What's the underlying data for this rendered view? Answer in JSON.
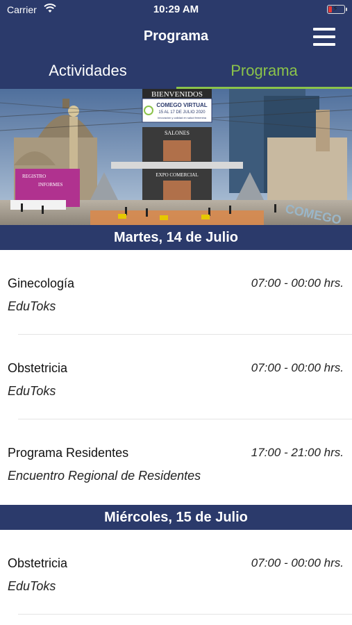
{
  "status_bar": {
    "carrier": "Carrier",
    "time": "10:29 AM",
    "battery_level": 0.15
  },
  "nav": {
    "title": "Programa",
    "menu_icon": "hamburger-menu-icon"
  },
  "tabs": [
    {
      "label": "Actividades",
      "active": false
    },
    {
      "label": "Programa",
      "active": true
    }
  ],
  "banner": {
    "welcome": "BIENVENIDOS",
    "event_title": "COMEGO VIRTUAL",
    "event_dates": "15 AL 17 DE JULIO 2020",
    "event_tagline": "Innovación y calidad en salud femenina",
    "booth_top": "SALONES",
    "booth_bottom": "EXPO COMERCIAL",
    "side_sign_1": "REGISTRO",
    "side_sign_2": "INFORMES",
    "corner_logo": "COMEGO"
  },
  "days": [
    {
      "label": "Martes, 14 de Julio",
      "items": [
        {
          "name": "Ginecología",
          "time": "07:00 - 00:00 hrs.",
          "sub": "EduToks"
        },
        {
          "name": "Obstetricia",
          "time": "07:00 - 00:00 hrs.",
          "sub": "EduToks"
        },
        {
          "name": "Programa Residentes",
          "time": "17:00 - 21:00 hrs.",
          "sub": "Encuentro Regional de Residentes"
        }
      ]
    },
    {
      "label": "Miércoles, 15 de Julio",
      "items": [
        {
          "name": "Obstetricia",
          "time": "07:00 - 00:00 hrs.",
          "sub": "EduToks"
        }
      ]
    }
  ],
  "colors": {
    "nav_bg": "#2b3a6b",
    "accent": "#8bc34a",
    "divider": "#e4e4e4"
  }
}
